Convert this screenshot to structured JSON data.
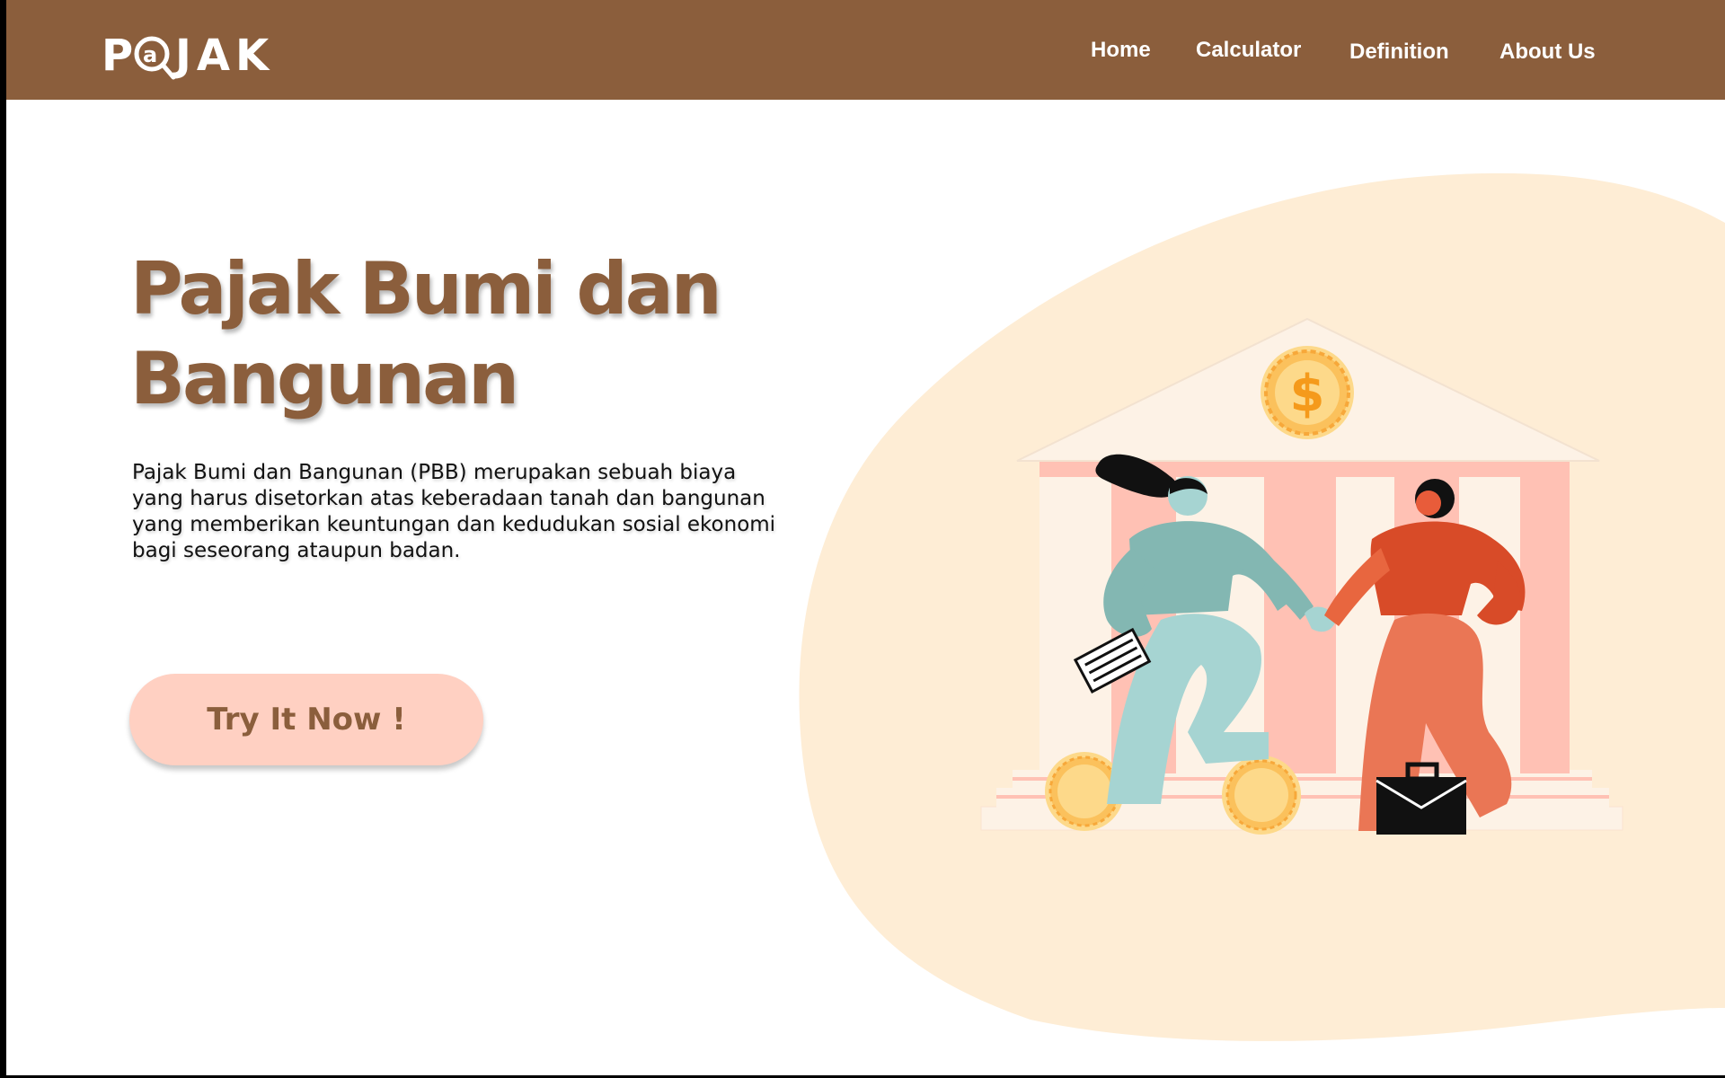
{
  "header": {
    "logo_text": "P@JAK",
    "nav": {
      "home": "Home",
      "calculator": "Calculator",
      "definition": "Definition",
      "about": "About Us"
    }
  },
  "hero": {
    "title_line1": "Pajak Bumi dan",
    "title_line2": "Bangunan",
    "description": "Pajak Bumi dan Bangunan (PBB) merupakan sebuah biaya yang harus disetorkan atas keberadaan tanah dan bangunan yang memberikan keuntungan dan kedudukan sosial ekonomi bagi seseorang ataupun badan.",
    "cta_label": "Try It Now !"
  },
  "illustration": {
    "coin_symbol": "$"
  },
  "colors": {
    "header_bg": "#8b5e3c",
    "blob": "#feedd5",
    "title": "#8b5e3c",
    "cta_bg": "#ffd0c2"
  }
}
